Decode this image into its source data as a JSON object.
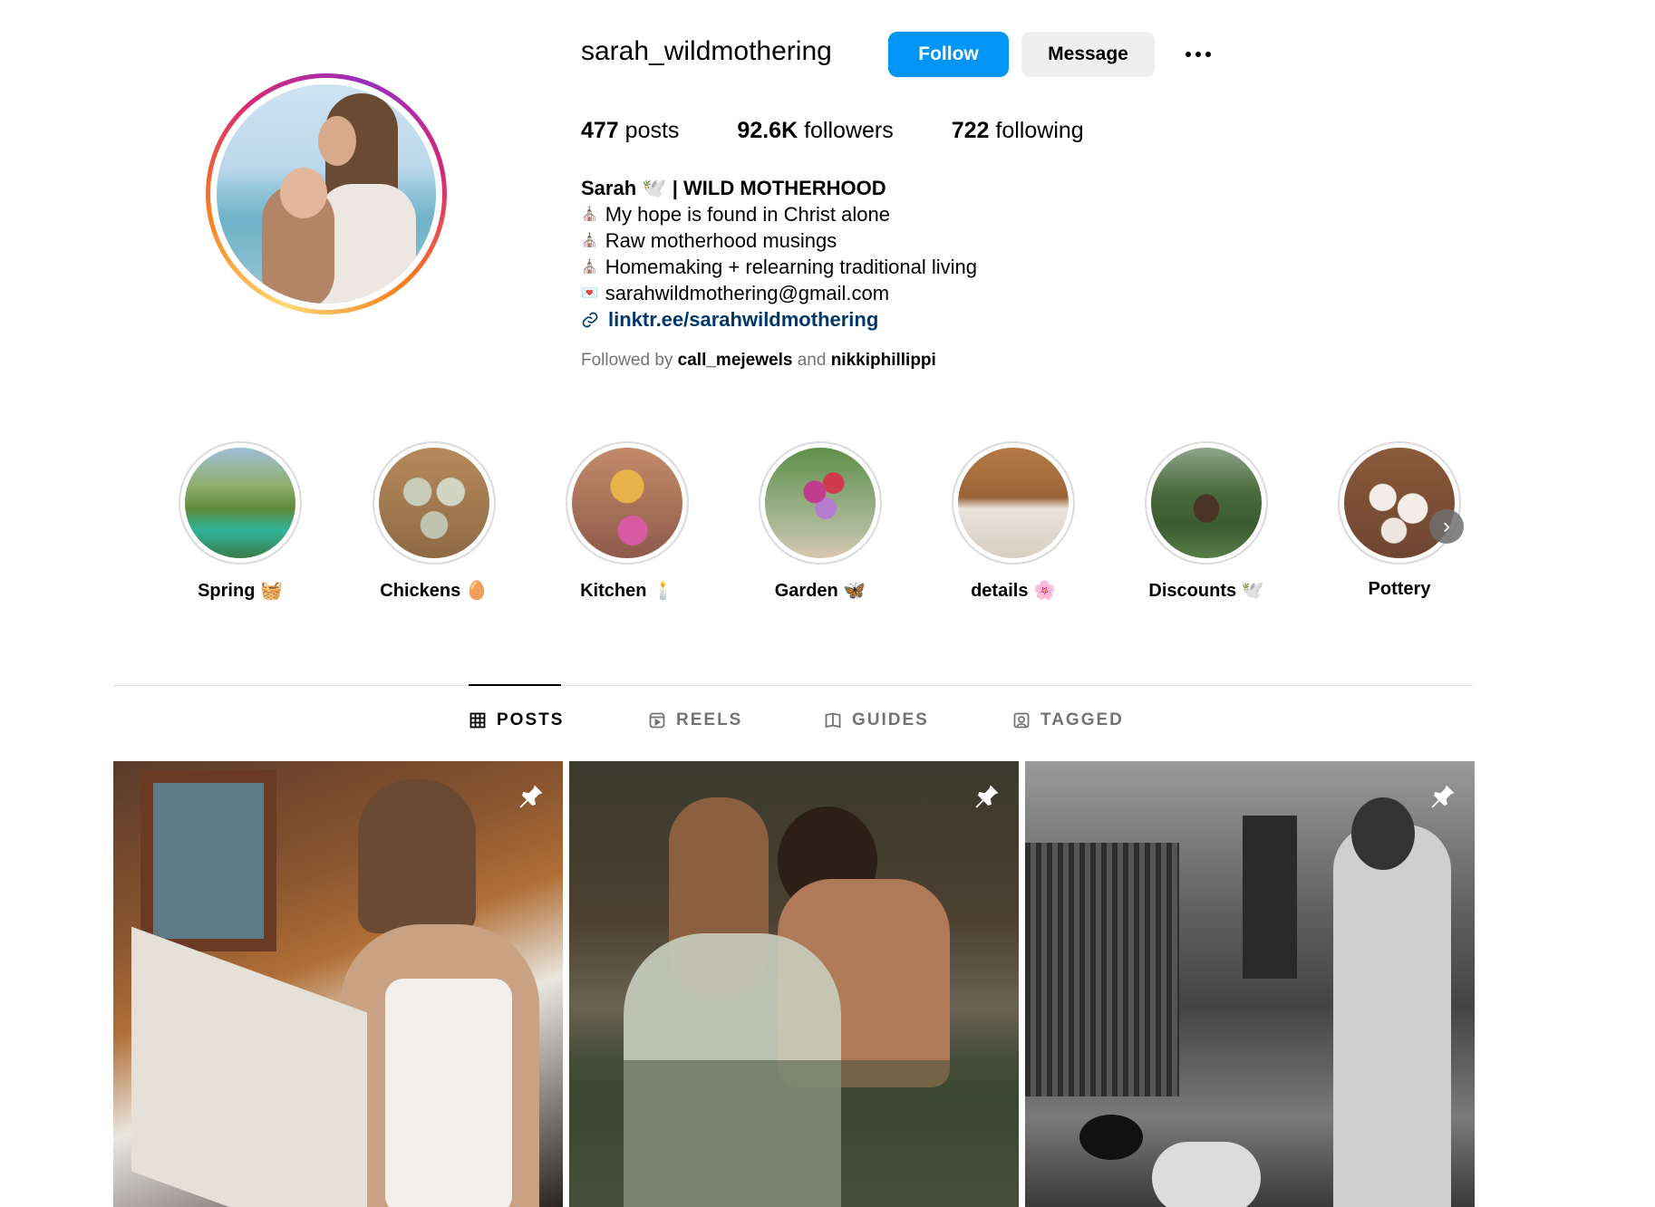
{
  "profile": {
    "username": "sarah_wildmothering",
    "follow_label": "Follow",
    "message_label": "Message",
    "more_icon": "ellipsis-icon",
    "avatar_ring_colors": [
      "#feda75",
      "#fa7e1e",
      "#d62976",
      "#962fbf"
    ]
  },
  "stats": [
    {
      "value": "477",
      "label": " posts"
    },
    {
      "value": "92.6K",
      "label": " followers"
    },
    {
      "value": "722",
      "label": " following"
    }
  ],
  "bio": {
    "name": "Sarah 🕊️ | WILD MOTHERHOOD",
    "lines": [
      {
        "emoji": "⛪",
        "text": "My hope is found in Christ alone"
      },
      {
        "emoji": "⛪",
        "text": "Raw motherhood musings"
      },
      {
        "emoji": "⛪",
        "text": "Homemaking + relearning traditional living"
      },
      {
        "emoji": "💌",
        "text": "sarahwildmothering@gmail.com"
      }
    ],
    "link": "linktr.ee/sarahwildmothering"
  },
  "followed_by": {
    "prefix": "Followed by ",
    "user1": "call_mejewels",
    "joiner": " and ",
    "user2": "nikkiphillippi"
  },
  "highlights": [
    {
      "label": "Spring 🧺"
    },
    {
      "label": "Chickens 🥚"
    },
    {
      "label": "Kitchen 🕯️"
    },
    {
      "label": "Garden 🦋"
    },
    {
      "label": "details 🌸"
    },
    {
      "label": "Discounts 🕊️"
    },
    {
      "label": "Pottery"
    }
  ],
  "tabs": [
    {
      "label": "POSTS",
      "icon": "grid-icon",
      "active": true
    },
    {
      "label": "REELS",
      "icon": "reels-icon",
      "active": false
    },
    {
      "label": "GUIDES",
      "icon": "guides-icon",
      "active": false
    },
    {
      "label": "TAGGED",
      "icon": "tagged-icon",
      "active": false
    }
  ],
  "posts": [
    {
      "pinned": true
    },
    {
      "pinned": true
    },
    {
      "pinned": true
    }
  ],
  "colors": {
    "accent": "#0095f6",
    "link": "#00376b",
    "muted": "#737373",
    "divider": "#dbdbdb"
  }
}
